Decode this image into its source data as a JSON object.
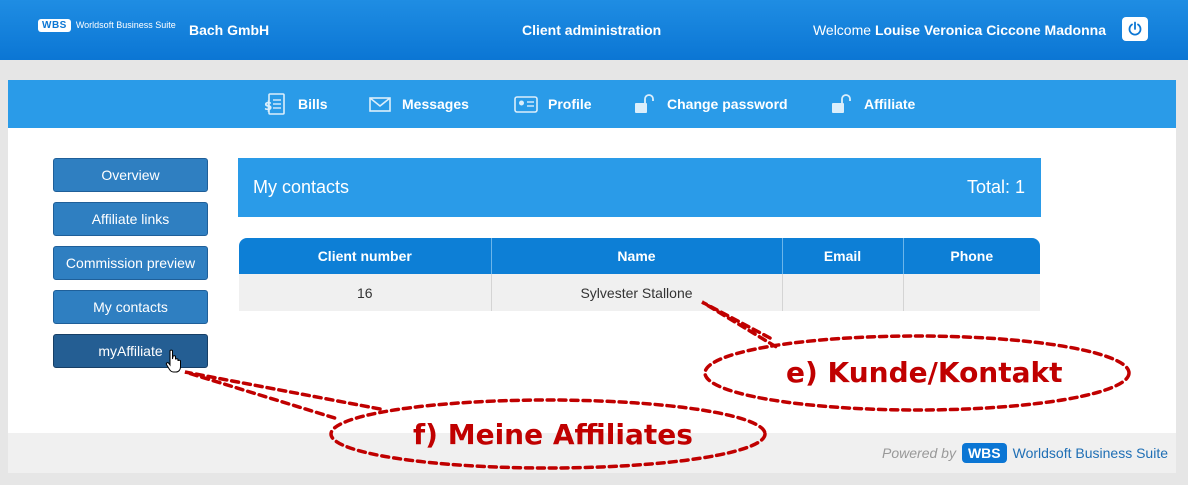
{
  "header": {
    "logo_badge": "WBS",
    "logo_text": "Worldsoft Business Suite",
    "company": "Bach GmbH",
    "page_heading": "Client administration",
    "welcome_prefix": "Welcome",
    "user_name": "Louise Veronica Ciccone Madonna",
    "power_icon": "power-icon"
  },
  "nav": {
    "items": [
      {
        "label": "Bills",
        "icon": "bills-icon"
      },
      {
        "label": "Messages",
        "icon": "envelope-icon"
      },
      {
        "label": "Profile",
        "icon": "id-card-icon"
      },
      {
        "label": "Change password",
        "icon": "unlock-icon"
      },
      {
        "label": "Affiliate",
        "icon": "unlock-icon"
      }
    ]
  },
  "sidebar": {
    "items": [
      {
        "label": "Overview"
      },
      {
        "label": "Affiliate links"
      },
      {
        "label": "Commission preview"
      },
      {
        "label": "My contacts"
      },
      {
        "label": "myAffiliate",
        "active": true
      }
    ]
  },
  "contacts": {
    "title": "My contacts",
    "total": "Total: 1",
    "columns": [
      "Client number",
      "Name",
      "Email",
      "Phone"
    ],
    "rows": [
      {
        "client_number": "16",
        "name": "Sylvester Stallone",
        "email": "",
        "phone": ""
      }
    ]
  },
  "footer": {
    "powered_by": "Powered by",
    "badge": "WBS",
    "suite": "Worldsoft Business Suite"
  },
  "annotations": {
    "kunde": "e) Kunde/Kontakt",
    "affiliates": "f) Meine Affiliates",
    "color": "#c00000"
  }
}
